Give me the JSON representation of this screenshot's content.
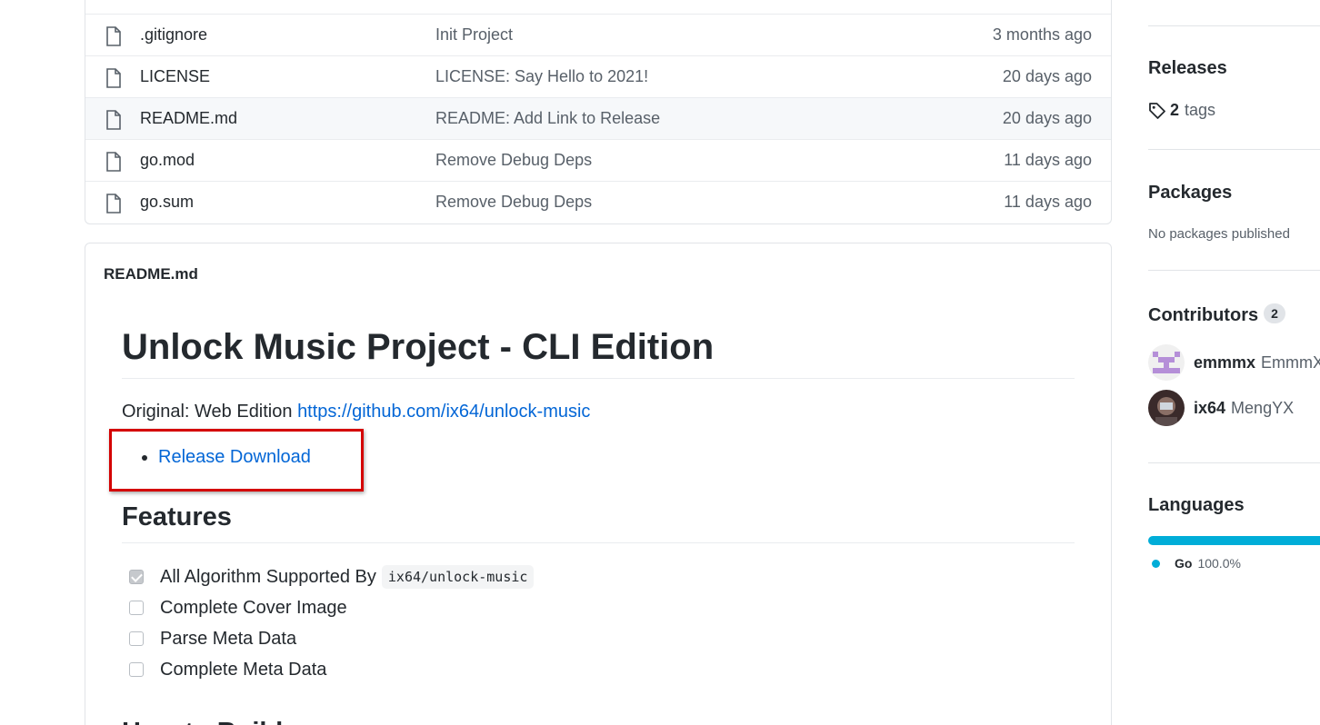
{
  "files": [
    {
      "name": ".gitignore",
      "message": "Init Project",
      "age": "3 months ago"
    },
    {
      "name": "LICENSE",
      "message": "LICENSE: Say Hello to 2021!",
      "age": "20 days ago"
    },
    {
      "name": "README.md",
      "message": "README: Add Link to Release",
      "age": "20 days ago"
    },
    {
      "name": "go.mod",
      "message": "Remove Debug Deps",
      "age": "11 days ago"
    },
    {
      "name": "go.sum",
      "message": "Remove Debug Deps",
      "age": "11 days ago"
    }
  ],
  "readme": {
    "header": "README.md",
    "title": "Unlock Music Project - CLI Edition",
    "original_prefix": "Original: Web Edition",
    "original_link": "https://github.com/ix64/unlock-music",
    "release_link": "Release Download",
    "features_heading": "Features",
    "features": [
      {
        "text": "All Algorithm Supported By",
        "code": "ix64/unlock-music",
        "checked": true
      },
      {
        "text": "Complete Cover Image",
        "checked": false
      },
      {
        "text": "Parse Meta Data",
        "checked": false
      },
      {
        "text": "Complete Meta Data",
        "checked": false
      }
    ],
    "howto_heading": "How to Build"
  },
  "sidebar": {
    "releases_title": "Releases",
    "tags_count": "2",
    "tags_label": "tags",
    "packages_title": "Packages",
    "packages_empty": "No packages published",
    "contributors_title": "Contributors",
    "contributors_count": "2",
    "contributors": [
      {
        "login": "emmmx",
        "name": "EmmmX"
      },
      {
        "login": "ix64",
        "name": "MengYX"
      }
    ],
    "languages_title": "Languages",
    "languages": [
      {
        "name": "Go",
        "percent": "100.0%",
        "color": "#00add8"
      }
    ]
  },
  "colors": {
    "link": "#0366d6",
    "highlight": "#d40000"
  }
}
